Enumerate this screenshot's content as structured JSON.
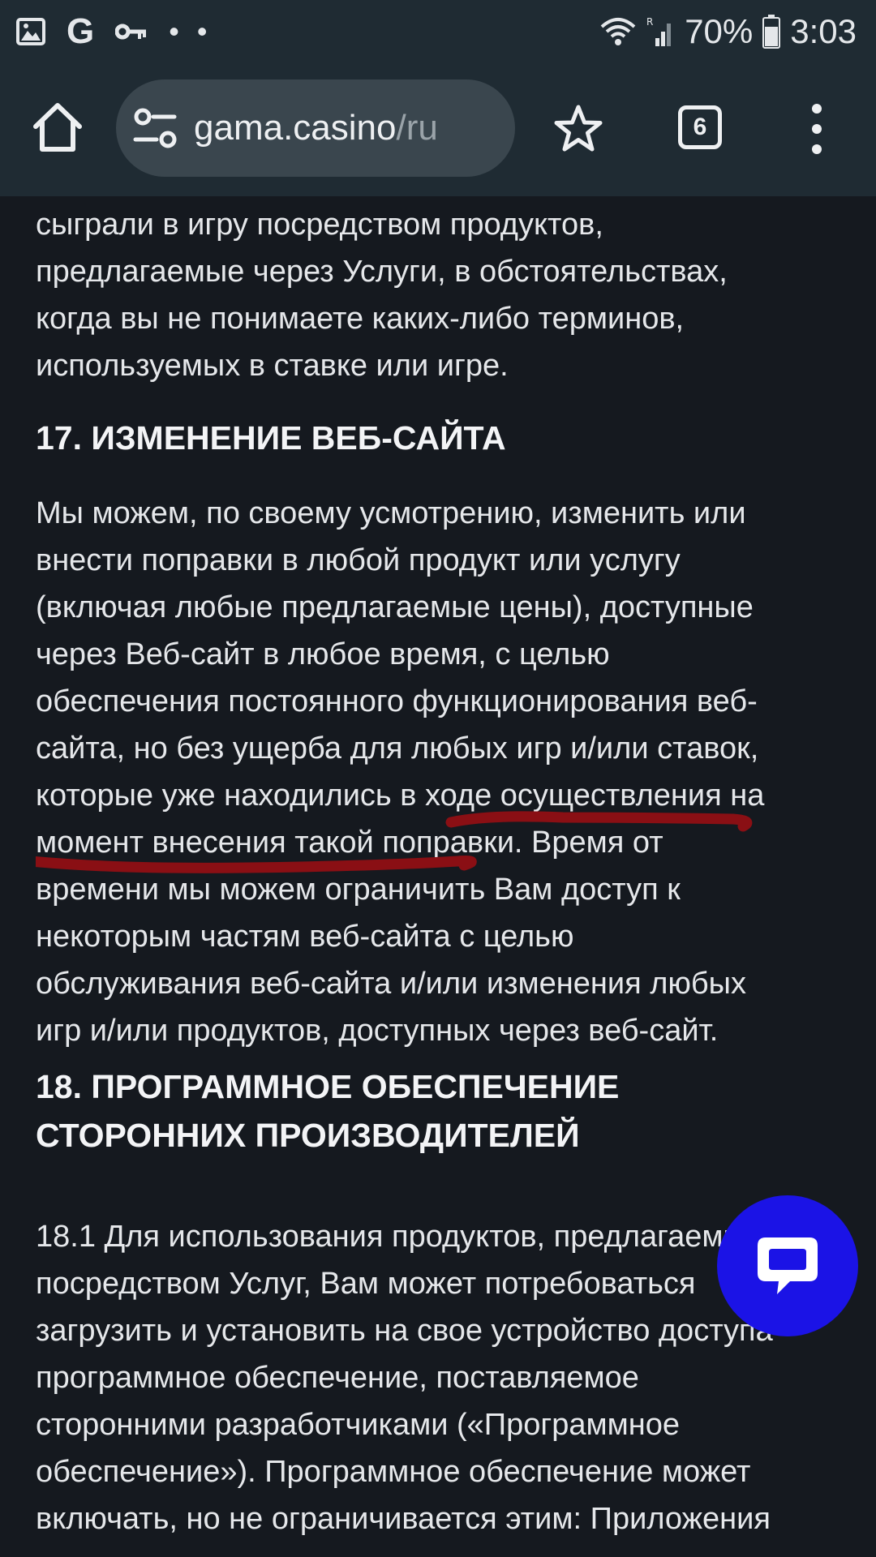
{
  "status_bar": {
    "icons_left": [
      "image-icon",
      "google-icon",
      "key-icon",
      "more-dots-icon"
    ],
    "google_letter": "G",
    "dots": "• •",
    "battery_percent": "70%",
    "time": "3:03"
  },
  "toolbar": {
    "url_host": "gama.casino",
    "url_path": "/ru",
    "tabs_count": "6"
  },
  "content": {
    "para1_lines": [
      "сыграли в игру посредством продуктов,",
      "предлагаемые через Услуги, в обстоятельствах,",
      "когда вы не понимаете каких-либо терминов,",
      "используемых в ставке или игре."
    ],
    "section17_title": "17. ИЗМЕНЕНИЕ ВЕБ-САЙТА",
    "para2_lines": [
      "Мы можем, по своему усмотрению, изменить или",
      "внести поправки в любой продукт или услугу",
      "(включая любые предлагаемые цены), доступные",
      "через Веб-сайт в любое время, с целью",
      "обеспечения постоянного функционирования веб-",
      "сайта, но без ущерба для любых игр и/или ставок,",
      "которые уже находились в ходе осуществления на",
      "момент внесения такой поправки. Время от",
      "времени мы можем ограничить Вам доступ к",
      "некоторым частям веб-сайта с целью",
      "обслуживания веб-сайта и/или изменения любых",
      "игр и/или продуктов, доступных через веб-сайт."
    ],
    "section18_title_lines": [
      "18. ПРОГРАММНОЕ ОБЕСПЕЧЕНИЕ",
      "СТОРОННИХ ПРОИЗВОДИТЕЛЕЙ"
    ],
    "para3_lines": [
      "18.1 Для использования продуктов, предлагаемых",
      "посредством Услуг, Вам может потребоваться",
      "загрузить и установить на свое устройство доступа",
      "программное обеспечение, поставляемое",
      "сторонними разработчиками («Программное",
      "обеспечение»). Программное обеспечение может",
      "включать, но не ограничивается этим: Приложения"
    ]
  },
  "colors": {
    "page_background": "#15191f",
    "toolbar_background": "#1f2b33",
    "url_bar_background": "#3a464e",
    "chat_button": "#1b13e6",
    "annotation_underline": "#8a0f14"
  }
}
